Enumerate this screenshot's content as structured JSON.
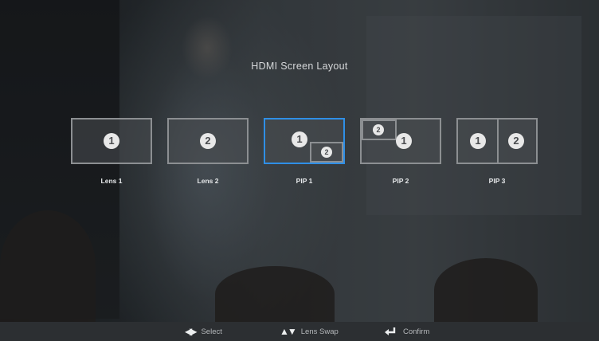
{
  "title": "HDMI Screen Layout",
  "layouts": [
    {
      "label": "Lens 1",
      "primary": "1",
      "secondary": ""
    },
    {
      "label": "Lens 2",
      "primary": "2",
      "secondary": ""
    },
    {
      "label": "PIP 1",
      "primary": "1",
      "secondary": "2"
    },
    {
      "label": "PIP 2",
      "primary": "1",
      "secondary": "2"
    },
    {
      "label": "PIP 3",
      "primary": "1",
      "secondary": "2"
    }
  ],
  "selected_layout": "PIP 1",
  "accent_color": "#2f8fe6",
  "bottom_bar": {
    "select_label": "Select",
    "swap_label": "Lens Swap",
    "confirm_label": "Confirm"
  },
  "icons": {
    "select": "left-right-arrows-icon",
    "swap": "up-down-arrows-icon",
    "confirm": "enter-return-icon"
  }
}
